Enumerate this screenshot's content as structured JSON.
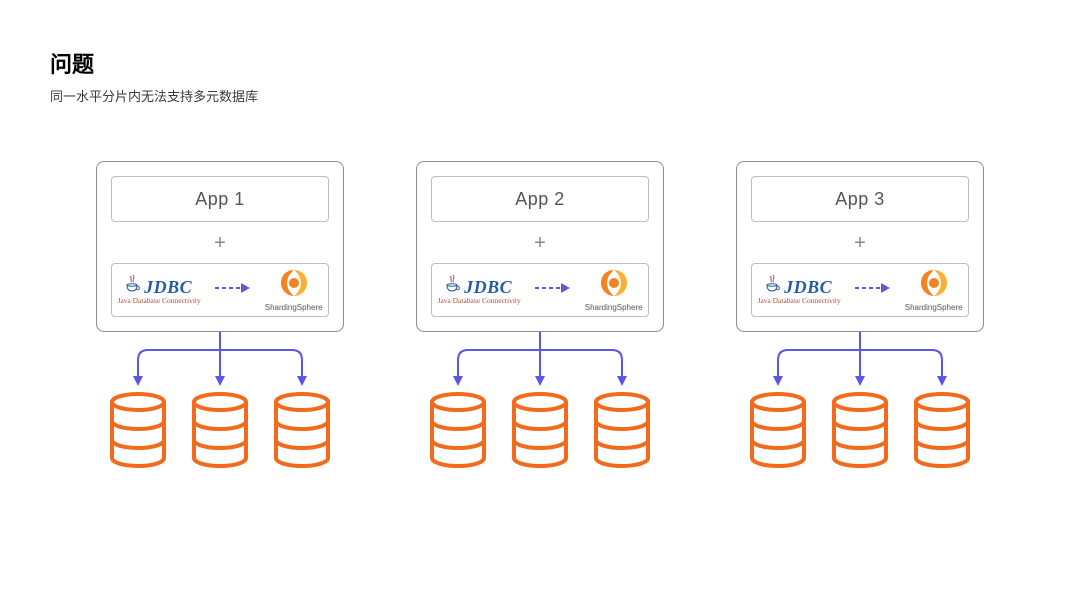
{
  "header": {
    "title": "问题",
    "subtitle": "同一水平分片内无法支持多元数据库"
  },
  "units": [
    {
      "app_label": "App 1",
      "plus": "+",
      "jdbc_acronym": "JDBC",
      "jdbc_tagline": "Java Database Connectivity",
      "sphere_label": "ShardingSphere"
    },
    {
      "app_label": "App 2",
      "plus": "+",
      "jdbc_acronym": "JDBC",
      "jdbc_tagline": "Java Database Connectivity",
      "sphere_label": "ShardingSphere"
    },
    {
      "app_label": "App 3",
      "plus": "+",
      "jdbc_acronym": "JDBC",
      "jdbc_tagline": "Java Database Connectivity",
      "sphere_label": "ShardingSphere"
    }
  ],
  "colors": {
    "arrow": "#5b58e5",
    "db_stroke": "#f26a1b",
    "sphere_orange": "#f58220",
    "sphere_yellow": "#fbb034",
    "jdbc_blue": "#295aa6",
    "jdbc_red": "#c04a3a"
  },
  "diagram": {
    "db_per_unit": 3,
    "unit_count": 3
  }
}
